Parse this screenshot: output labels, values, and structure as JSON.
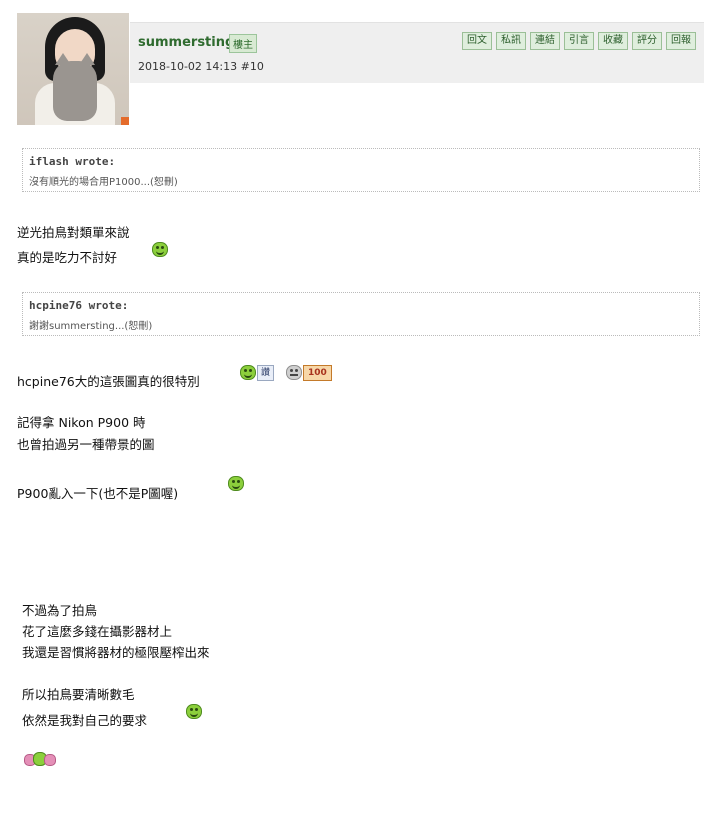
{
  "post": {
    "username": "summersting",
    "badge": "樓主",
    "timestamp": "2018-10-02 14:13",
    "floor": "#10",
    "actions": [
      "回文",
      "私訊",
      "連結",
      "引言",
      "收藏",
      "評分",
      "回報"
    ]
  },
  "quotes": [
    {
      "author": "iflash wrote:",
      "body": "沒有順光的場合用P1000...(恕刪)"
    },
    {
      "author": "hcpine76 wrote:",
      "body": "謝謝summersting...(恕刪)"
    }
  ],
  "content": {
    "p1_line1": "逆光拍鳥對類單來說",
    "p1_line2": "真的是吃力不討好",
    "p2_line1": "hcpine76大的這張圖真的很特別",
    "tag_read": "讚",
    "tag_100": "100",
    "p3_line1": "記得拿 Nikon P900 時",
    "p3_line2": "也曾拍過另一種帶景的圖",
    "p4_line1": "P900亂入一下(也不是P圖喔)",
    "p5_line1": "不過為了拍鳥",
    "p5_line2": "花了這麼多錢在攝影器材上",
    "p5_line3": "我還是習慣將器材的極限壓榨出來",
    "p6_line1": "所以拍鳥要清晰數毛",
    "p6_line2": "依然是我對自己的要求"
  }
}
